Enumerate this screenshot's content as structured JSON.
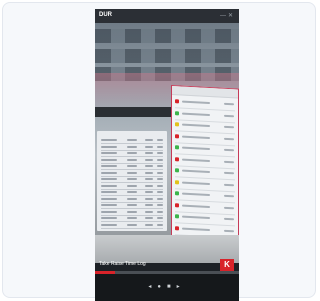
{
  "app": {
    "brand": "DUR",
    "caption": "Take Raise Time Log",
    "logo_letter": "K"
  },
  "player": {
    "progress": 0.14,
    "controls": [
      "◂",
      "●",
      "■",
      "▸"
    ]
  },
  "colors": {
    "accent": "#d8232a",
    "panel_border": "#c63b58",
    "status_green": "#3cb44b",
    "status_red": "#d8232a",
    "status_yellow": "#e2c21c"
  },
  "right_panel_status": [
    "red",
    "green",
    "yellow",
    "red",
    "green",
    "red",
    "green",
    "yellow",
    "green",
    "red",
    "green",
    "red",
    "green",
    "red"
  ]
}
